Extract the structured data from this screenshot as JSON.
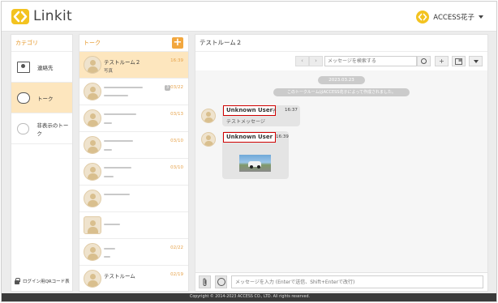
{
  "header": {
    "logo_text": "Linkit",
    "account_name": "ACCESS花子"
  },
  "categories": {
    "title": "カテゴリ",
    "items": [
      {
        "label": "連絡先",
        "icon": "contact-card-icon"
      },
      {
        "label": "トーク",
        "icon": "chat-bubble-icon",
        "active": true
      },
      {
        "label": "非表示のトーク",
        "icon": "hidden-chat-icon"
      }
    ],
    "qr_label": "ログイン用QRコード表"
  },
  "talks": {
    "title": "トーク",
    "items": [
      {
        "name": "テストルーム２",
        "sub": "写真",
        "time": "16:39",
        "active": true
      },
      {
        "name": "",
        "sub": "",
        "time": "03/22",
        "badge": "3"
      },
      {
        "name": "",
        "sub": "",
        "time": "03/13"
      },
      {
        "name": "",
        "sub": "",
        "time": "03/10"
      },
      {
        "name": "",
        "sub": "",
        "time": "03/10"
      },
      {
        "name": "",
        "sub": "",
        "time": ""
      },
      {
        "name": "",
        "sub": "",
        "time": ""
      },
      {
        "name": "",
        "sub": "",
        "time": "02/22"
      },
      {
        "name": "テストルーム",
        "sub": "",
        "time": "02/19"
      }
    ]
  },
  "chat": {
    "title": "テストルーム２",
    "search_placeholder": "メッセージを検索する",
    "date": "2023.03.23",
    "system_message": "このトークルームはACCESS花子によって作成されました。",
    "messages": [
      {
        "sender": "Unknown User",
        "sender_suffix": "子",
        "time": "16:37",
        "text": "テストメッセージ"
      },
      {
        "sender": "Unknown User",
        "time": "16:39",
        "image": true
      }
    ],
    "input_placeholder": "メッセージを入力 (Enterで送信、Shift+Enterで改行)"
  },
  "footer": {
    "copyright": "Copyright © 2014-2023 ACCESS CO., LTD. All rights reserved."
  },
  "colors": {
    "accent": "#f2a73e",
    "accent_text": "#e59422",
    "active_bg": "#fde6be",
    "highlight_border": "#d00000"
  }
}
